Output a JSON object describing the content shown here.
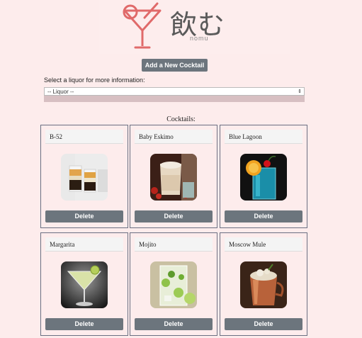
{
  "logo": {
    "title": "飲む",
    "subtitle": "nomu"
  },
  "actions": {
    "add_label": "Add a New Cocktail"
  },
  "liquor_select": {
    "label": "Select a liquor for more information:",
    "value": "-- Liquor --"
  },
  "cocktails": {
    "heading": "Cocktails:",
    "delete_label": "Delete",
    "items": [
      {
        "name": "B-52"
      },
      {
        "name": "Baby Eskimo"
      },
      {
        "name": "Blue Lagoon"
      },
      {
        "name": "Margarita"
      },
      {
        "name": "Mojito"
      },
      {
        "name": "Moscow Mule"
      }
    ]
  },
  "colors": {
    "background": "#fdecec",
    "button": "#6c757d",
    "logo_glass": "#e06a6a"
  }
}
